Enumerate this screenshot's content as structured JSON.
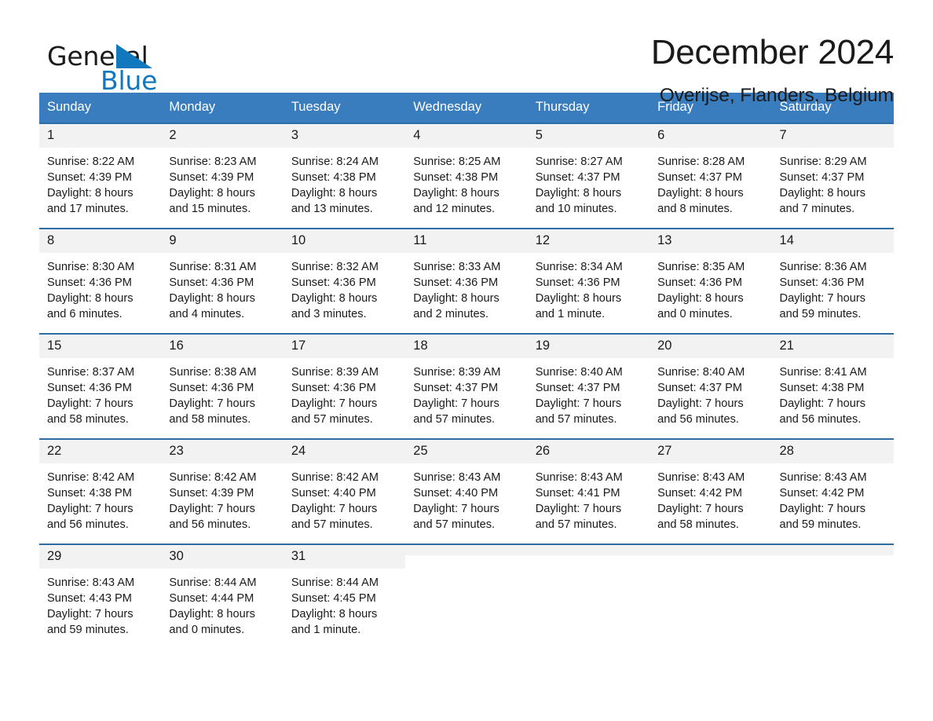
{
  "brand": {
    "word_one": "General",
    "word_two": "Blue",
    "triangle_icon": "triangle-icon",
    "accent_color": "#1278be"
  },
  "header": {
    "month_title": "December 2024",
    "location": "Overijse, Flanders, Belgium"
  },
  "calendar": {
    "header_bg": "#3a7dbf",
    "day_header_text_color": "#ffffff",
    "daynum_bg": "#f2f2f2",
    "cell_border_color": "#2e6da4",
    "weekday_headers": [
      "Sunday",
      "Monday",
      "Tuesday",
      "Wednesday",
      "Thursday",
      "Friday",
      "Saturday"
    ],
    "weeks": [
      [
        {
          "day": "1",
          "sunrise": "Sunrise: 8:22 AM",
          "sunset": "Sunset: 4:39 PM",
          "daylight_1": "Daylight: 8 hours",
          "daylight_2": "and 17 minutes."
        },
        {
          "day": "2",
          "sunrise": "Sunrise: 8:23 AM",
          "sunset": "Sunset: 4:39 PM",
          "daylight_1": "Daylight: 8 hours",
          "daylight_2": "and 15 minutes."
        },
        {
          "day": "3",
          "sunrise": "Sunrise: 8:24 AM",
          "sunset": "Sunset: 4:38 PM",
          "daylight_1": "Daylight: 8 hours",
          "daylight_2": "and 13 minutes."
        },
        {
          "day": "4",
          "sunrise": "Sunrise: 8:25 AM",
          "sunset": "Sunset: 4:38 PM",
          "daylight_1": "Daylight: 8 hours",
          "daylight_2": "and 12 minutes."
        },
        {
          "day": "5",
          "sunrise": "Sunrise: 8:27 AM",
          "sunset": "Sunset: 4:37 PM",
          "daylight_1": "Daylight: 8 hours",
          "daylight_2": "and 10 minutes."
        },
        {
          "day": "6",
          "sunrise": "Sunrise: 8:28 AM",
          "sunset": "Sunset: 4:37 PM",
          "daylight_1": "Daylight: 8 hours",
          "daylight_2": "and 8 minutes."
        },
        {
          "day": "7",
          "sunrise": "Sunrise: 8:29 AM",
          "sunset": "Sunset: 4:37 PM",
          "daylight_1": "Daylight: 8 hours",
          "daylight_2": "and 7 minutes."
        }
      ],
      [
        {
          "day": "8",
          "sunrise": "Sunrise: 8:30 AM",
          "sunset": "Sunset: 4:36 PM",
          "daylight_1": "Daylight: 8 hours",
          "daylight_2": "and 6 minutes."
        },
        {
          "day": "9",
          "sunrise": "Sunrise: 8:31 AM",
          "sunset": "Sunset: 4:36 PM",
          "daylight_1": "Daylight: 8 hours",
          "daylight_2": "and 4 minutes."
        },
        {
          "day": "10",
          "sunrise": "Sunrise: 8:32 AM",
          "sunset": "Sunset: 4:36 PM",
          "daylight_1": "Daylight: 8 hours",
          "daylight_2": "and 3 minutes."
        },
        {
          "day": "11",
          "sunrise": "Sunrise: 8:33 AM",
          "sunset": "Sunset: 4:36 PM",
          "daylight_1": "Daylight: 8 hours",
          "daylight_2": "and 2 minutes."
        },
        {
          "day": "12",
          "sunrise": "Sunrise: 8:34 AM",
          "sunset": "Sunset: 4:36 PM",
          "daylight_1": "Daylight: 8 hours",
          "daylight_2": "and 1 minute."
        },
        {
          "day": "13",
          "sunrise": "Sunrise: 8:35 AM",
          "sunset": "Sunset: 4:36 PM",
          "daylight_1": "Daylight: 8 hours",
          "daylight_2": "and 0 minutes."
        },
        {
          "day": "14",
          "sunrise": "Sunrise: 8:36 AM",
          "sunset": "Sunset: 4:36 PM",
          "daylight_1": "Daylight: 7 hours",
          "daylight_2": "and 59 minutes."
        }
      ],
      [
        {
          "day": "15",
          "sunrise": "Sunrise: 8:37 AM",
          "sunset": "Sunset: 4:36 PM",
          "daylight_1": "Daylight: 7 hours",
          "daylight_2": "and 58 minutes."
        },
        {
          "day": "16",
          "sunrise": "Sunrise: 8:38 AM",
          "sunset": "Sunset: 4:36 PM",
          "daylight_1": "Daylight: 7 hours",
          "daylight_2": "and 58 minutes."
        },
        {
          "day": "17",
          "sunrise": "Sunrise: 8:39 AM",
          "sunset": "Sunset: 4:36 PM",
          "daylight_1": "Daylight: 7 hours",
          "daylight_2": "and 57 minutes."
        },
        {
          "day": "18",
          "sunrise": "Sunrise: 8:39 AM",
          "sunset": "Sunset: 4:37 PM",
          "daylight_1": "Daylight: 7 hours",
          "daylight_2": "and 57 minutes."
        },
        {
          "day": "19",
          "sunrise": "Sunrise: 8:40 AM",
          "sunset": "Sunset: 4:37 PM",
          "daylight_1": "Daylight: 7 hours",
          "daylight_2": "and 57 minutes."
        },
        {
          "day": "20",
          "sunrise": "Sunrise: 8:40 AM",
          "sunset": "Sunset: 4:37 PM",
          "daylight_1": "Daylight: 7 hours",
          "daylight_2": "and 56 minutes."
        },
        {
          "day": "21",
          "sunrise": "Sunrise: 8:41 AM",
          "sunset": "Sunset: 4:38 PM",
          "daylight_1": "Daylight: 7 hours",
          "daylight_2": "and 56 minutes."
        }
      ],
      [
        {
          "day": "22",
          "sunrise": "Sunrise: 8:42 AM",
          "sunset": "Sunset: 4:38 PM",
          "daylight_1": "Daylight: 7 hours",
          "daylight_2": "and 56 minutes."
        },
        {
          "day": "23",
          "sunrise": "Sunrise: 8:42 AM",
          "sunset": "Sunset: 4:39 PM",
          "daylight_1": "Daylight: 7 hours",
          "daylight_2": "and 56 minutes."
        },
        {
          "day": "24",
          "sunrise": "Sunrise: 8:42 AM",
          "sunset": "Sunset: 4:40 PM",
          "daylight_1": "Daylight: 7 hours",
          "daylight_2": "and 57 minutes."
        },
        {
          "day": "25",
          "sunrise": "Sunrise: 8:43 AM",
          "sunset": "Sunset: 4:40 PM",
          "daylight_1": "Daylight: 7 hours",
          "daylight_2": "and 57 minutes."
        },
        {
          "day": "26",
          "sunrise": "Sunrise: 8:43 AM",
          "sunset": "Sunset: 4:41 PM",
          "daylight_1": "Daylight: 7 hours",
          "daylight_2": "and 57 minutes."
        },
        {
          "day": "27",
          "sunrise": "Sunrise: 8:43 AM",
          "sunset": "Sunset: 4:42 PM",
          "daylight_1": "Daylight: 7 hours",
          "daylight_2": "and 58 minutes."
        },
        {
          "day": "28",
          "sunrise": "Sunrise: 8:43 AM",
          "sunset": "Sunset: 4:42 PM",
          "daylight_1": "Daylight: 7 hours",
          "daylight_2": "and 59 minutes."
        }
      ],
      [
        {
          "day": "29",
          "sunrise": "Sunrise: 8:43 AM",
          "sunset": "Sunset: 4:43 PM",
          "daylight_1": "Daylight: 7 hours",
          "daylight_2": "and 59 minutes."
        },
        {
          "day": "30",
          "sunrise": "Sunrise: 8:44 AM",
          "sunset": "Sunset: 4:44 PM",
          "daylight_1": "Daylight: 8 hours",
          "daylight_2": "and 0 minutes."
        },
        {
          "day": "31",
          "sunrise": "Sunrise: 8:44 AM",
          "sunset": "Sunset: 4:45 PM",
          "daylight_1": "Daylight: 8 hours",
          "daylight_2": "and 1 minute."
        },
        {
          "day": "",
          "sunrise": "",
          "sunset": "",
          "daylight_1": "",
          "daylight_2": ""
        },
        {
          "day": "",
          "sunrise": "",
          "sunset": "",
          "daylight_1": "",
          "daylight_2": ""
        },
        {
          "day": "",
          "sunrise": "",
          "sunset": "",
          "daylight_1": "",
          "daylight_2": ""
        },
        {
          "day": "",
          "sunrise": "",
          "sunset": "",
          "daylight_1": "",
          "daylight_2": ""
        }
      ]
    ]
  }
}
